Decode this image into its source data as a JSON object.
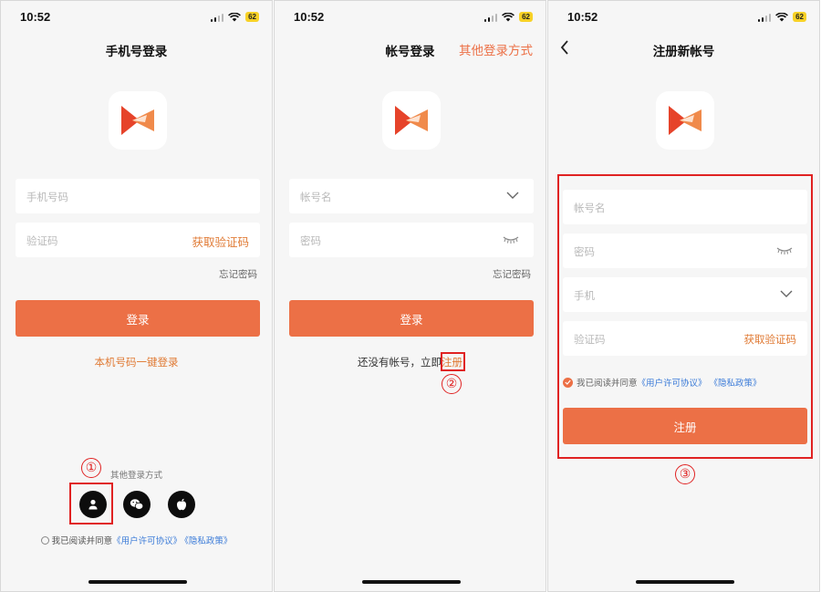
{
  "screens": [
    {
      "status": {
        "time": "10:52",
        "battery": "62"
      },
      "title": "手机号登录",
      "fields": {
        "phone_placeholder": "手机号码",
        "code_placeholder": "验证码",
        "get_code": "获取验证码"
      },
      "forgot": "忘记密码",
      "login_button": "登录",
      "one_key_login": "本机号码一键登录",
      "other_methods": "其他登录方式",
      "social_icons": [
        "user-icon",
        "wechat-icon",
        "apple-icon"
      ],
      "agreement": {
        "prefix": "我已阅读并同意",
        "terms": "《用户许可协议》",
        "privacy": "《隐私政策》"
      },
      "annotation": "①"
    },
    {
      "status": {
        "time": "10:52",
        "battery": "62"
      },
      "title": "帐号登录",
      "other_login": "其他登录方式",
      "fields": {
        "account_placeholder": "帐号名",
        "password_placeholder": "密码"
      },
      "forgot": "忘记密码",
      "login_button": "登录",
      "no_account": "还没有帐号，立即",
      "register_link": "注册",
      "annotation": "②"
    },
    {
      "status": {
        "time": "10:52",
        "battery": "62"
      },
      "title": "注册新帐号",
      "fields": {
        "account_placeholder": "帐号名",
        "password_placeholder": "密码",
        "phone_placeholder": "手机",
        "code_placeholder": "验证码",
        "get_code": "获取验证码"
      },
      "agreement": {
        "prefix": "我已阅读并同意",
        "terms": "《用户许可协议》",
        "privacy": "《隐私政策》"
      },
      "register_button": "注册",
      "annotation": "③"
    }
  ],
  "colors": {
    "accent": "#ec7046",
    "link_orange": "#e07a34",
    "link_blue": "#3b7bd8",
    "annotation_red": "#e02222",
    "battery": "#f7d126"
  }
}
